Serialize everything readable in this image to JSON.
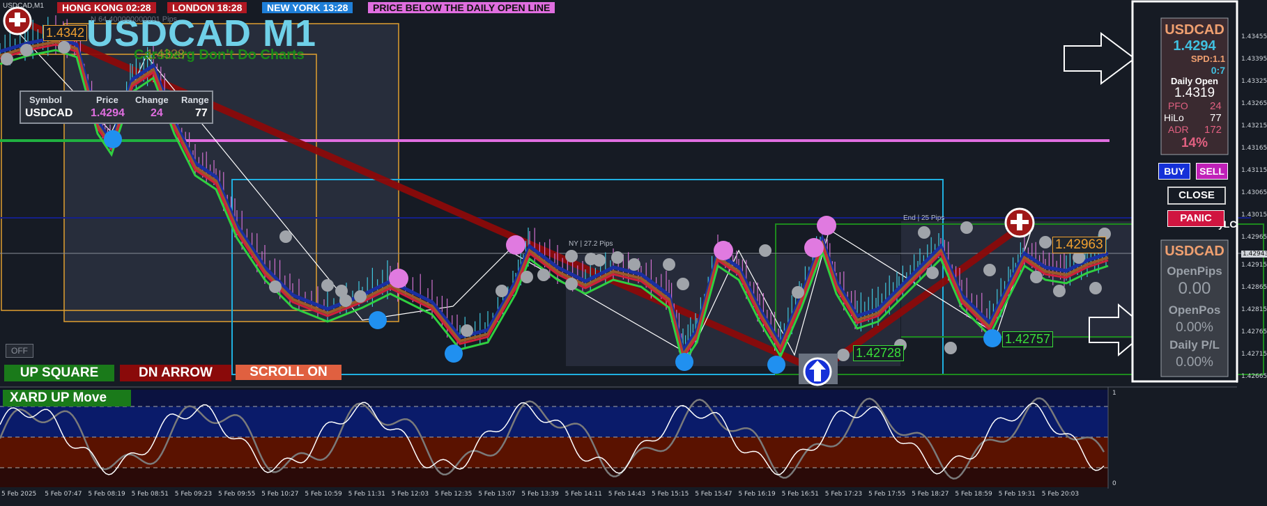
{
  "window": {
    "title": "USDCAD,M1"
  },
  "sessions": [
    {
      "label": "HONG KONG 02:28",
      "color": "#b01822"
    },
    {
      "label": "LONDON 18:28",
      "color": "#b01822"
    },
    {
      "label": "NEW YORK 13:28",
      "color": "#1f7fd8"
    },
    {
      "label": "PRICE BELOW THE DAILY OPEN LINE",
      "color": "#e06ee0"
    }
  ],
  "chart_title": "USDCAD M1",
  "chart_subtitle": "Carsberg Don't Do Charts",
  "faded_text": "N 64.400000000001 Pips",
  "symbol_table": {
    "headers": [
      "Symbol",
      "Price",
      "Change",
      "Range"
    ],
    "row": [
      "USDCAD",
      "1.4294",
      "24",
      "77"
    ]
  },
  "price_labels": {
    "top_left": "1.4342",
    "top_left_2": "1.4328",
    "right": "1.42963",
    "low_1": "1.42728",
    "low_2": "1.42757"
  },
  "box_labels": {
    "ny": "NY | 27.2 Pips",
    "end": "End | 25 Pips"
  },
  "controls": {
    "off": "OFF",
    "up_square": "UP SQUARE",
    "dn_arrow": "DN ARROW",
    "scroll_on": "SCROLL ON",
    "buy": "BUY",
    "sell": "SELL",
    "close": "CLOSE",
    "panic": "PANIC"
  },
  "indicator_label": "XARD UP Move",
  "info_panel": {
    "symbol": "USDCAD",
    "price": "1.4294",
    "spread": "SPD:1.1",
    "time": "0:7",
    "daily_open_label": "Daily Open",
    "daily_open": "1.4319",
    "pfo_label": "PFO",
    "pfo": "24",
    "hilo_label": "HiLo",
    "hilo": "77",
    "adr_label": "ADR",
    "adr": "172",
    "pct": "14%"
  },
  "pl_panel": {
    "symbol": "USDCAD",
    "open_pips_label": "OpenPips",
    "open_pips": "0.00",
    "open_pos_label": "OpenPos",
    "open_pos": "0.00%",
    "daily_pl_label": "Daily P/L",
    "daily_pl": "0.00%"
  },
  "price_axis": [
    "1.43455",
    "1.43395",
    "1.43325",
    "1.43265",
    "1.43215",
    "1.43165",
    "1.43115",
    "1.43065",
    "1.43015",
    "1.42965",
    "1.42943",
    "1.42915",
    "1.42865",
    "1.42815",
    "1.42765",
    "1.42715",
    "1.42665"
  ],
  "osc_axis": [
    "1",
    "0"
  ],
  "time_axis": [
    "5 Feb 2025",
    "5 Feb 07:47",
    "5 Feb 08:19",
    "5 Feb 08:51",
    "5 Feb 09:23",
    "5 Feb 09:55",
    "5 Feb 10:27",
    "5 Feb 10:59",
    "5 Feb 11:31",
    "5 Feb 12:03",
    "5 Feb 12:35",
    "5 Feb 13:07",
    "5 Feb 13:39",
    "5 Feb 14:11",
    "5 Feb 14:43",
    "5 Feb 15:15",
    "5 Feb 15:47",
    "5 Feb 16:19",
    "5 Feb 16:51",
    "5 Feb 17:23",
    "5 Feb 17:55",
    "5 Feb 18:27",
    "5 Feb 18:59",
    "5 Feb 19:31",
    "5 Feb 20:03"
  ],
  "edge_text": "yLC",
  "colors": {
    "background": "#161b24",
    "daily_open_line": "#e06ee0",
    "trend_line": "#8b0a0a",
    "hk_box": "#e0a030",
    "ny_box": "#1fb0e0",
    "end_box": "#1d8a1d",
    "buy": "#1530d8",
    "sell": "#c020b8",
    "panic": "#d01540"
  }
}
